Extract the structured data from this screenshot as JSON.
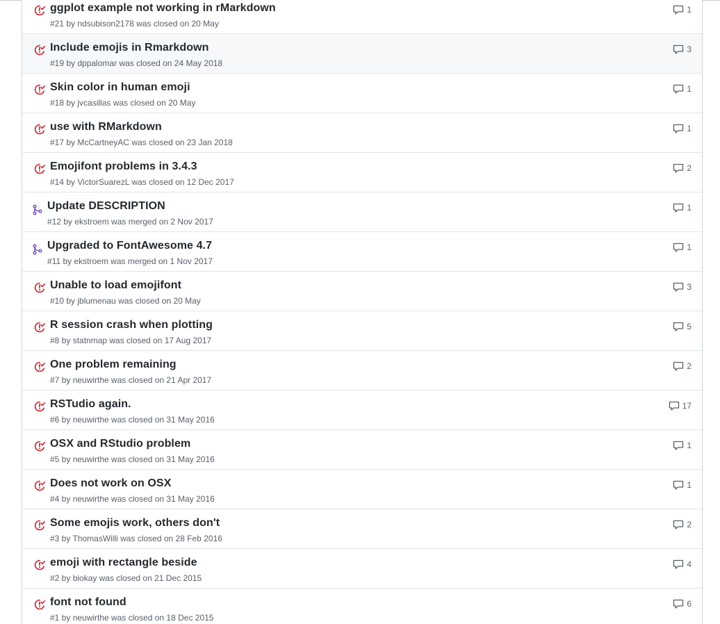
{
  "colors": {
    "closed_issue": "#cb2431",
    "merged_pr": "#6f42c1",
    "title": "#24292e",
    "meta": "#586069",
    "border": "#e1e4e8",
    "hover_row": "#f6f8fa"
  },
  "issues": [
    {
      "type": "closed-issue",
      "icon": "issue-closed-icon",
      "title": "ggplot example not working in rMarkdown",
      "meta": "#21 by ndsubison2178 was closed on 20 May",
      "comments": "1"
    },
    {
      "type": "closed-issue",
      "icon": "issue-closed-icon",
      "title": "Include emojis in Rmarkdown",
      "meta": "#19 by dppalomar was closed on 24 May 2018",
      "comments": "3",
      "hover": true
    },
    {
      "type": "closed-issue",
      "icon": "issue-closed-icon",
      "title": "Skin color in human emoji",
      "meta": "#18 by jvcasillas was closed on 20 May",
      "comments": "1"
    },
    {
      "type": "closed-issue",
      "icon": "issue-closed-icon",
      "title": "use with RMarkdown",
      "meta": "#17 by McCartneyAC was closed on 23 Jan 2018",
      "comments": "1"
    },
    {
      "type": "closed-issue",
      "icon": "issue-closed-icon",
      "title": "Emojifont problems in 3.4.3",
      "meta": "#14 by VictorSuarezL was closed on 12 Dec 2017",
      "comments": "2"
    },
    {
      "type": "merged-pr",
      "icon": "git-merge-icon",
      "title": "Update DESCRIPTION",
      "meta": "#12 by ekstroem was merged on 2 Nov 2017",
      "comments": "1"
    },
    {
      "type": "merged-pr",
      "icon": "git-merge-icon",
      "title": "Upgraded to FontAwesome 4.7",
      "meta": "#11 by ekstroem was merged on 1 Nov 2017",
      "comments": "1"
    },
    {
      "type": "closed-issue",
      "icon": "issue-closed-icon",
      "title": "Unable to load emojifont",
      "meta": "#10 by jblumenau was closed on 20 May",
      "comments": "3"
    },
    {
      "type": "closed-issue",
      "icon": "issue-closed-icon",
      "title": "R session crash when plotting",
      "meta": "#8 by statnmap was closed on 17 Aug 2017",
      "comments": "5"
    },
    {
      "type": "closed-issue",
      "icon": "issue-closed-icon",
      "title": "One problem remaining",
      "meta": "#7 by neuwirthe was closed on 21 Apr 2017",
      "comments": "2"
    },
    {
      "type": "closed-issue",
      "icon": "issue-closed-icon",
      "title": "RSTudio again.",
      "meta": "#6 by neuwirthe was closed on 31 May 2016",
      "comments": "17"
    },
    {
      "type": "closed-issue",
      "icon": "issue-closed-icon",
      "title": "OSX and RStudio problem",
      "meta": "#5 by neuwirthe was closed on 31 May 2016",
      "comments": "1"
    },
    {
      "type": "closed-issue",
      "icon": "issue-closed-icon",
      "title": "Does not work on OSX",
      "meta": "#4 by neuwirthe was closed on 31 May 2016",
      "comments": "1"
    },
    {
      "type": "closed-issue",
      "icon": "issue-closed-icon",
      "title": "Some emojis work, others don't",
      "meta": "#3 by ThomasWilli was closed on 28 Feb 2016",
      "comments": "2"
    },
    {
      "type": "closed-issue",
      "icon": "issue-closed-icon",
      "title": "emoji with rectangle beside",
      "meta": "#2 by biokay was closed on 21 Dec 2015",
      "comments": "4"
    },
    {
      "type": "closed-issue",
      "icon": "issue-closed-icon",
      "title": "font not found",
      "meta": "#1 by neuwirthe was closed on 18 Dec 2015",
      "comments": "6"
    }
  ]
}
